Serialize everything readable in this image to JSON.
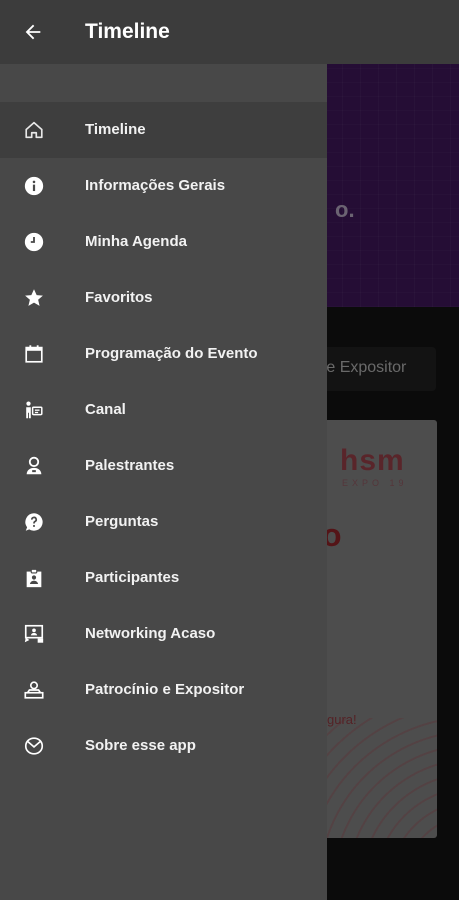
{
  "app_bar": {
    "title": "Timeline",
    "back_icon": "arrow-left-icon"
  },
  "drawer": {
    "items": [
      {
        "label": "Timeline",
        "icon": "home-icon",
        "active": true
      },
      {
        "label": "Informações Gerais",
        "icon": "info-icon",
        "active": false
      },
      {
        "label": "Minha Agenda",
        "icon": "clock-icon",
        "active": false
      },
      {
        "label": "Favoritos",
        "icon": "star-icon",
        "active": false
      },
      {
        "label": "Programação do Evento",
        "icon": "calendar-icon",
        "active": false
      },
      {
        "label": "Canal",
        "icon": "channel-icon",
        "active": false
      },
      {
        "label": "Palestrantes",
        "icon": "speaker-icon",
        "active": false
      },
      {
        "label": "Perguntas",
        "icon": "question-icon",
        "active": false
      },
      {
        "label": "Participantes",
        "icon": "badge-icon",
        "active": false
      },
      {
        "label": "Networking Acaso",
        "icon": "networking-icon",
        "active": false
      },
      {
        "label": "Patrocínio e Expositor",
        "icon": "sponsor-icon",
        "active": false
      },
      {
        "label": "Sobre esse app",
        "icon": "about-icon",
        "active": false
      }
    ]
  },
  "background": {
    "banner_text": "o.",
    "chip_label": "o e Expositor",
    "card_logo": "hsm",
    "card_logo_sub": "EXPO 19",
    "card_big_letter": "o",
    "card_small_text": "gura!"
  },
  "colors": {
    "app_bar": "#3c3c3c",
    "drawer": "#484848",
    "active_item": "#3e3e3e",
    "banner": "#4a1a6b"
  }
}
